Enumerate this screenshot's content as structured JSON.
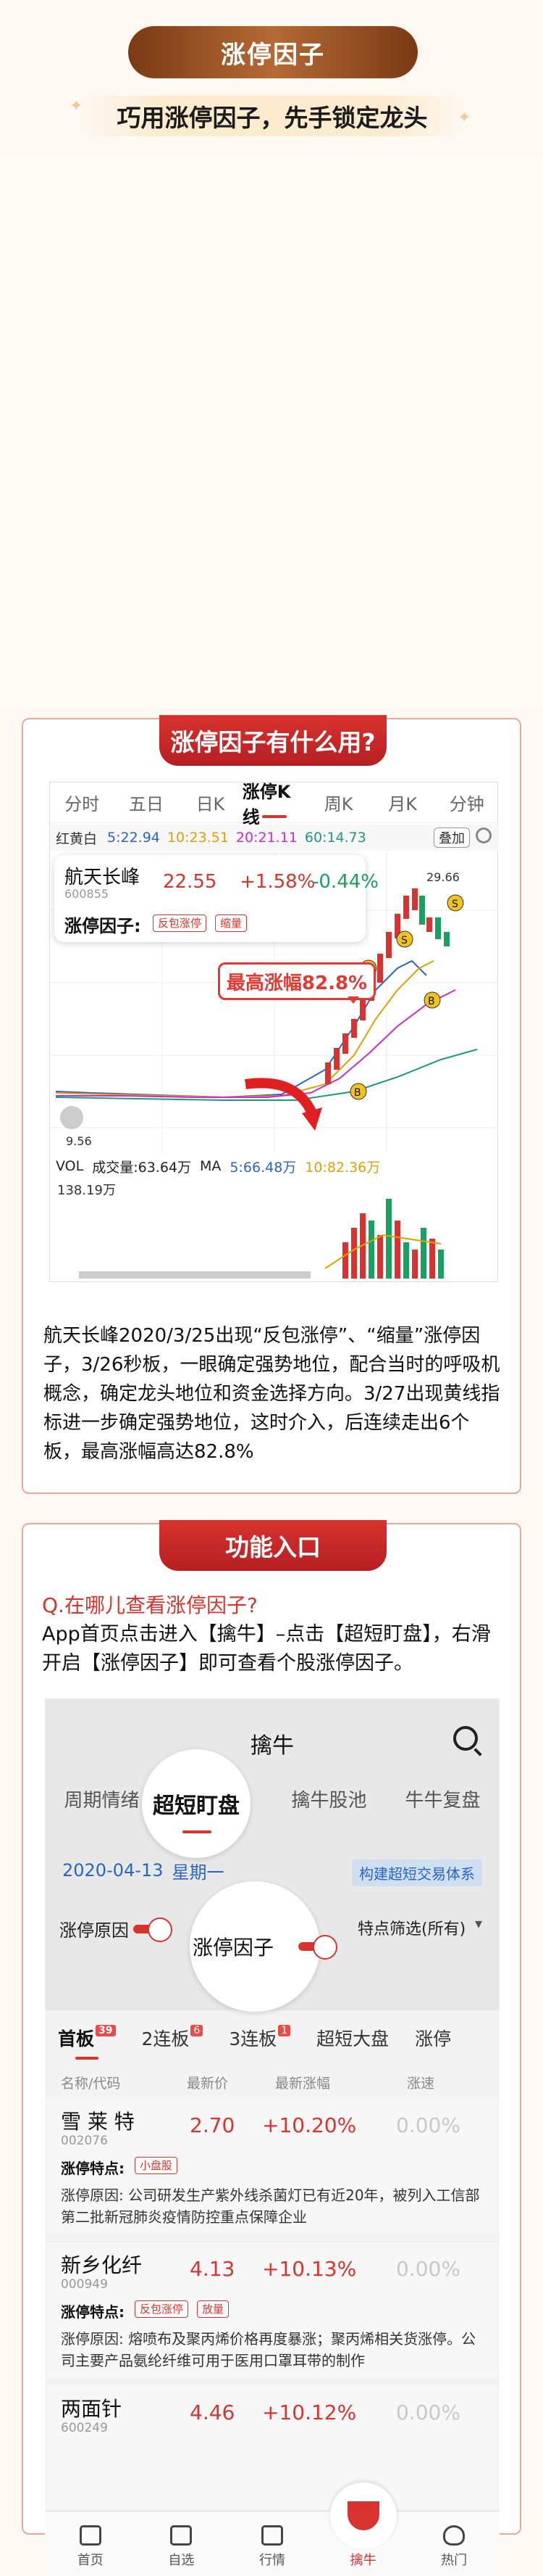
{
  "header": {
    "title": "涨停因子",
    "subtitle": "巧用涨停因子，先手锁定龙头"
  },
  "section1": {
    "tab": "涨停因子有什么用?",
    "period_tabs": [
      "分时",
      "五日",
      "日K",
      "涨停K线",
      "周K",
      "月K",
      "分钟"
    ],
    "active_tab": "涨停K线",
    "ma_row": {
      "label": "红黄白",
      "ma5": "5:22.94",
      "ma10": "10:23.51",
      "ma20": "20:21.11",
      "ma60": "60:14.73",
      "overlay_btn": "叠加"
    },
    "stock": {
      "name": "航天长峰",
      "code": "600855",
      "price": "22.55",
      "change_pct": "+1.58%",
      "change_pct2": "-0.44%",
      "factor_label": "涨停因子:",
      "tags": [
        "反包涨停",
        "缩量"
      ]
    },
    "callout": "最高涨幅82.8%",
    "chart_labels": {
      "high": "29.66",
      "low": "9.56"
    },
    "volume": {
      "label": "VOL",
      "total": "成交量:63.64万",
      "ma": "MA",
      "ma5": "5:66.48万",
      "ma10": "10:82.36万",
      "axis_max": "138.19万"
    },
    "description": "航天长峰2020/3/25出现“反包涨停”、“缩量”涨停因子，3/26秒板，一眼确定强势地位，配合当时的呼吸机概念，确定龙头地位和资金选择方向。3/27出现黄线指标进一步确定强势地位，这时介入，后连续走出6个板，最高涨幅高达82.8%"
  },
  "section2": {
    "tab": "功能入口",
    "question": "Q.在哪儿查看涨停因子?",
    "answer": "App首页点击进入【擒牛】–点击【超短盯盘】，右滑开启【涨停因子】即可查看个股涨停因子。",
    "app": {
      "title": "擒牛",
      "subtabs": [
        "周期情绪",
        "超短盯盘",
        "擒牛股池",
        "牛牛复盘"
      ],
      "date": "2020-04-13",
      "weekday": "星期一",
      "system_btn": "构建超短交易体系",
      "filters": {
        "reason": "涨停原因",
        "factor": "涨停因子",
        "feature": "特点筛选(所有)"
      },
      "board_tabs": [
        {
          "label": "首板",
          "count": "39"
        },
        {
          "label": "2连板",
          "count": "6"
        },
        {
          "label": "3连板",
          "count": "1"
        },
        {
          "label": "超短大盘",
          "count": ""
        },
        {
          "label": "涨停",
          "count": ""
        }
      ],
      "columns": [
        "名称/代码",
        "最新价",
        "最新涨幅",
        "涨速"
      ],
      "rows": [
        {
          "name": "雪 莱 特",
          "code": "002076",
          "price": "2.70",
          "change": "+10.20%",
          "speed": "0.00%",
          "feature_label": "涨停特点:",
          "tags": [
            "小盘股"
          ],
          "reason": "涨停原因: 公司研发生产紫外线杀菌灯已有近20年，被列入工信部第二批新冠肺炎疫情防控重点保障企业"
        },
        {
          "name": "新乡化纤",
          "code": "000949",
          "price": "4.13",
          "change": "+10.13%",
          "speed": "0.00%",
          "feature_label": "涨停特点:",
          "tags": [
            "反包涨停",
            "放量"
          ],
          "reason": "涨停原因: 熔喷布及聚丙烯价格再度暴涨；聚丙烯相关货涨停。公司主要产品氨纶纤维可用于医用口罩耳带的制作"
        },
        {
          "name": "两面针",
          "code": "600249",
          "price": "4.46",
          "change": "+10.12%",
          "speed": "0.00%"
        }
      ],
      "nav": [
        "首页",
        "自选",
        "行情",
        "擒牛",
        "热门"
      ]
    }
  }
}
